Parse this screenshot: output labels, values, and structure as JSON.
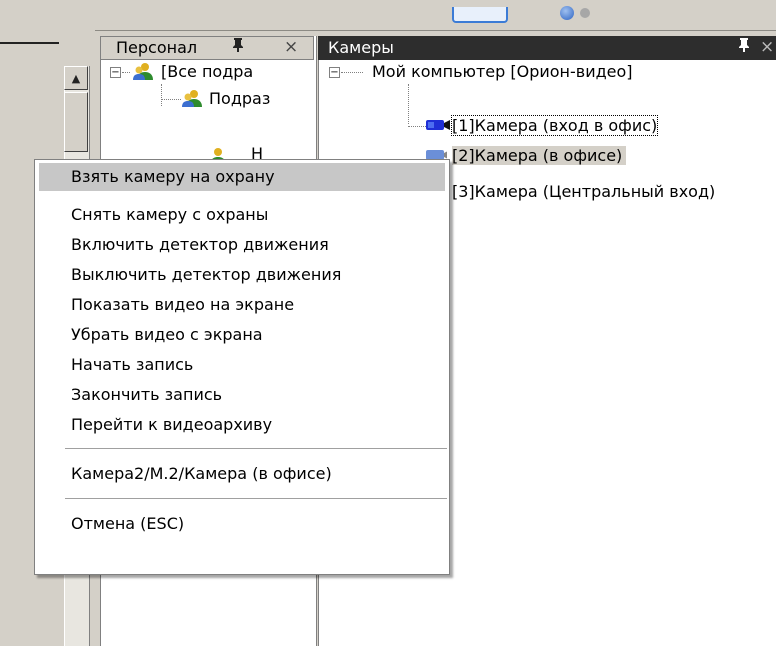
{
  "personnel_panel": {
    "title": "Персонал",
    "tree": {
      "root_label": "[Все подра",
      "child_label": "Подраз",
      "partial_label": "Н"
    }
  },
  "cameras_panel": {
    "title": "Камеры",
    "tree": {
      "root_label": "Мой компьютер [Орион-видео]",
      "cameras": [
        {
          "label": "[1]Камера (вход в офис)",
          "state": "focused"
        },
        {
          "label": "[2]Камера (в офисе)",
          "state": "selected"
        },
        {
          "label": "[3]Камера (Центральный вход)",
          "state": "normal"
        }
      ]
    }
  },
  "icons": {
    "pin": "pin-icon",
    "close": "close-icon",
    "expander": "minus-box-icon",
    "people": "people-group-icon",
    "camera": "video-camera-icon",
    "scroll_up": "arrow-up-icon"
  },
  "glyphs": {
    "pin": "ф",
    "close": "×",
    "minus": "−",
    "up": "▲"
  },
  "context_menu": {
    "items": [
      "Взять камеру на охрану",
      "Снять камеру с охраны",
      "Включить детектор движения",
      "Выключить детектор движения",
      "Показать видео на экране",
      "Убрать видео с экрана",
      "Начать запись",
      "Закончить запись",
      "Перейти к видеоархиву"
    ],
    "path_item": "Камера2/М.2/Камера (в офисе)",
    "cancel_item": "Отмена (ESC)",
    "highlighted_index": 0
  },
  "colors": {
    "panel_header_dark": "#2d2d2d",
    "window_face": "#d4d0c8",
    "menu_highlight": "#c7c7c7",
    "camera_blue": "#1f2fd6"
  }
}
